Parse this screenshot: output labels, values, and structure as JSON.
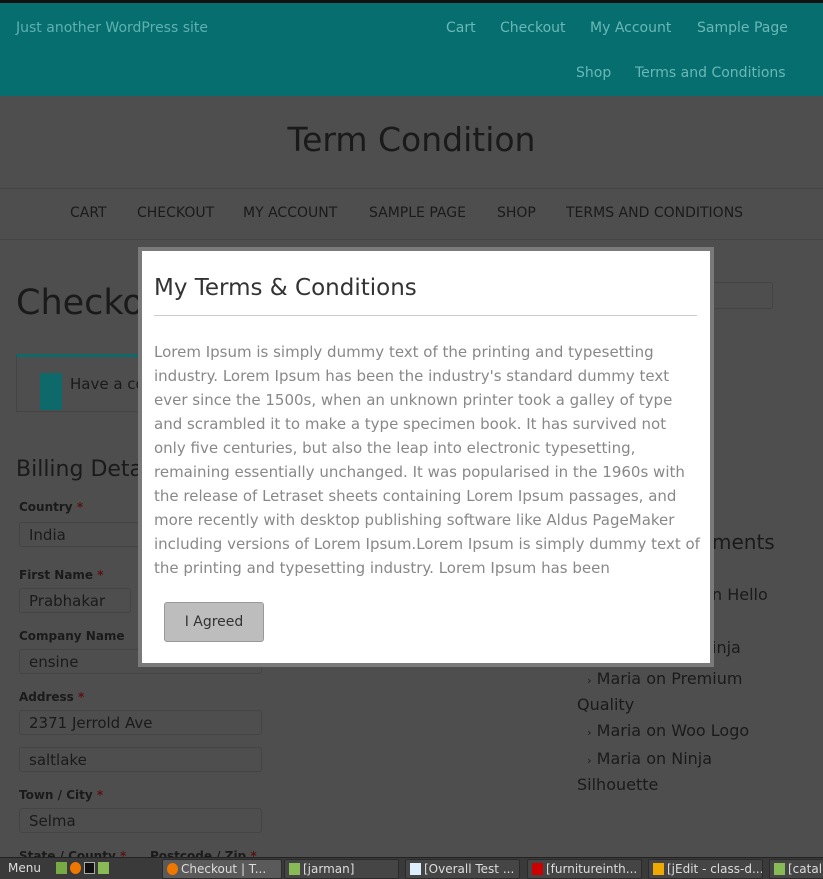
{
  "header": {
    "tagline": "Just another WordPress site",
    "nav": [
      "Cart",
      "Checkout",
      "My Account",
      "Sample Page",
      "Shop",
      "Terms and Conditions"
    ]
  },
  "site_title": "Term Condition",
  "main_nav": [
    "CART",
    "CHECKOUT",
    "MY ACCOUNT",
    "SAMPLE PAGE",
    "SHOP",
    "TERMS AND CONDITIONS"
  ],
  "page": {
    "title_fragment": "Checko",
    "coupon_fragment": "Have a co",
    "billing_fragment": "Billing Deta"
  },
  "form": {
    "country_label": "Country",
    "country_value": "India",
    "first_name_label": "First Name",
    "first_name_value": "Prabhakar",
    "company_label": "Company Name",
    "company_value": "ensine",
    "address_label": "Address",
    "address_1": "2371 Jerrold Ave",
    "address_2": "saltlake",
    "town_label": "Town / City",
    "town_value": "Selma",
    "state_label": "State / County",
    "postcode_label": "Postcode / Zip",
    "required": "*"
  },
  "sidebar": {
    "frag1": "s",
    "frag2": "ments",
    "frag3": "n Hello",
    "frag4": "inja",
    "comments": [
      {
        "author": "Maria",
        "on": "on",
        "post": "Premium Quality"
      },
      {
        "author": "Maria",
        "on": "on",
        "post": "Woo Logo"
      },
      {
        "author": "Maria",
        "on": "on",
        "post": "Ninja Silhouette"
      }
    ]
  },
  "modal": {
    "title": "My Terms & Conditions",
    "body": "Lorem Ipsum is simply dummy text of the printing and typesetting industry. Lorem Ipsum has been the industry's standard dummy text ever since the 1500s, when an unknown printer took a galley of type and scrambled it to make a type specimen book. It has survived not only five centuries, but also the leap into electronic typesetting, remaining essentially unchanged. It was popularised in the 1960s with the release of Letraset sheets containing Lorem Ipsum passages, and more recently with desktop publishing software like Aldus PageMaker including versions of Lorem Ipsum.Lorem Ipsum is simply dummy text of the printing and typesetting industry. Lorem Ipsum has been",
    "button": "I Agreed"
  },
  "taskbar": {
    "menu": "Menu",
    "windows": [
      "Checkout | T...",
      "[jarman]",
      "[Overall Test ...",
      "[furnitureinth...",
      "[jEdit - class-d...",
      "[catal"
    ]
  },
  "colors": {
    "header": "#066e6e",
    "accent": "#0e7a7a"
  }
}
